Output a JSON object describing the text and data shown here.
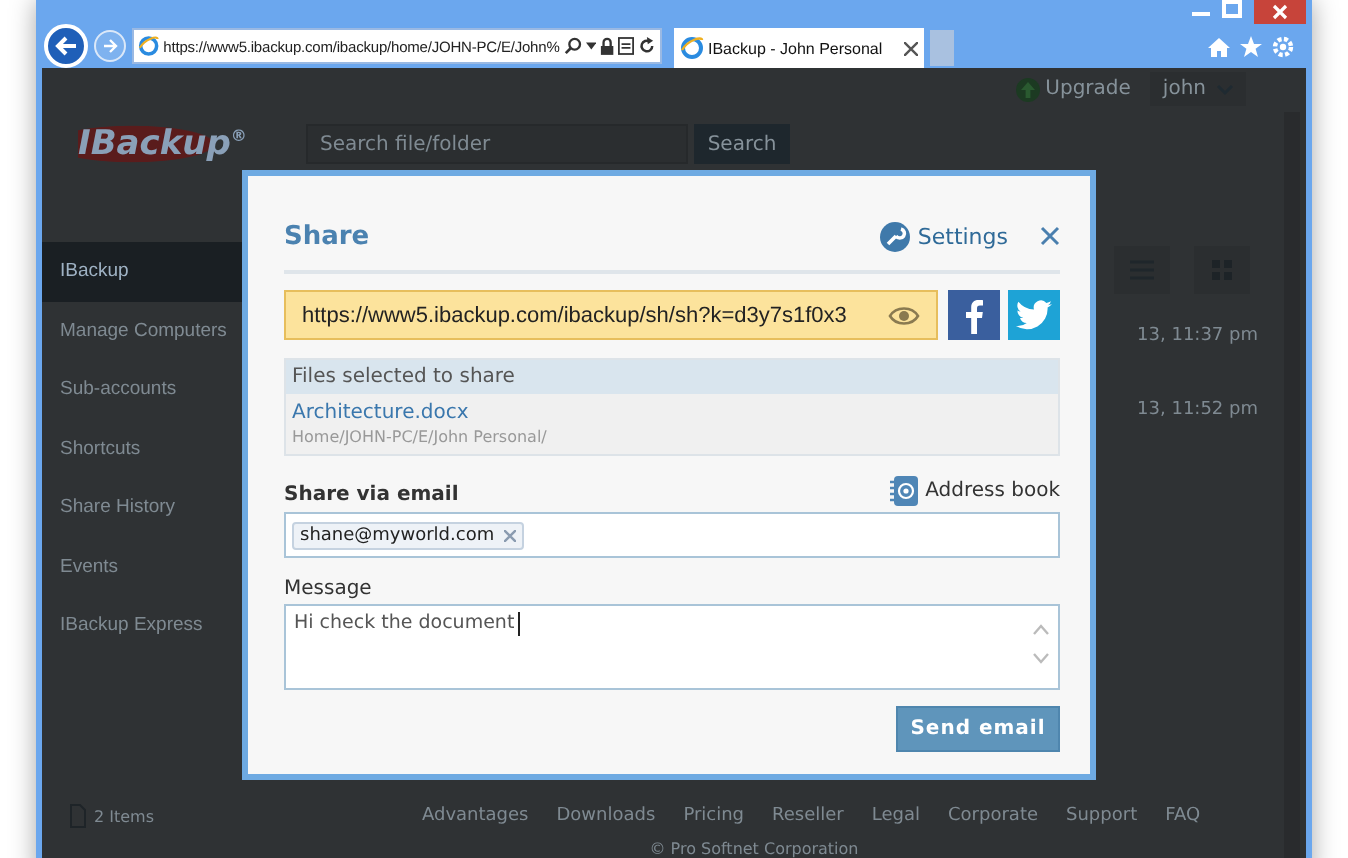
{
  "browser": {
    "url": "https://www5.ibackup.com/ibackup/home/JOHN-PC/E/John%",
    "tabs": [
      {
        "label": "IBackup - John Personal",
        "selected": true
      }
    ]
  },
  "page": {
    "top_bar": {
      "upgrade": "Upgrade",
      "user": "john"
    },
    "logo": "IBackup$^{®}$",
    "search": {
      "placeholder": "Search file/folder",
      "button": "Search"
    },
    "sidebar": {
      "items": [
        {
          "label": "IBackup",
          "selected": true
        },
        {
          "label": "Manage Computers",
          "selected": false
        },
        {
          "label": "Sub-accounts",
          "selected": false
        },
        {
          "label": "Shortcuts",
          "selected": false
        },
        {
          "label": "Share History",
          "selected": false
        },
        {
          "label": "Events",
          "selected": false
        },
        {
          "label": "IBackup Express",
          "selected": false
        }
      ]
    },
    "file_list": {
      "rows": [
        {
          "modified": "13, 11:37 pm"
        },
        {
          "modified": "13, 11:52 pm"
        }
      ]
    },
    "status": "2 Items",
    "footer": {
      "links": [
        "Advantages",
        "Downloads",
        "Pricing",
        "Reseller",
        "Legal",
        "Corporate",
        "Support",
        "FAQ"
      ],
      "copyright": "© Pro Softnet Corporation"
    }
  },
  "dialog": {
    "title": "Share",
    "settings": "Settings",
    "share_link": "https://www5.ibackup.com/ibackup/sh/sh?k=d3y7s1f0x3",
    "files": {
      "heading": "Files selected to share",
      "items": [
        {
          "name": "Architecture.docx",
          "path": "Home/JOHN-PC/E/John Personal/"
        }
      ]
    },
    "email": {
      "label": "Share via email",
      "address_book": "Address book",
      "recipients": [
        "shane@myworld.com"
      ]
    },
    "message": {
      "label": "Message",
      "value": "Hi check the document"
    },
    "send_button": "Send email"
  }
}
